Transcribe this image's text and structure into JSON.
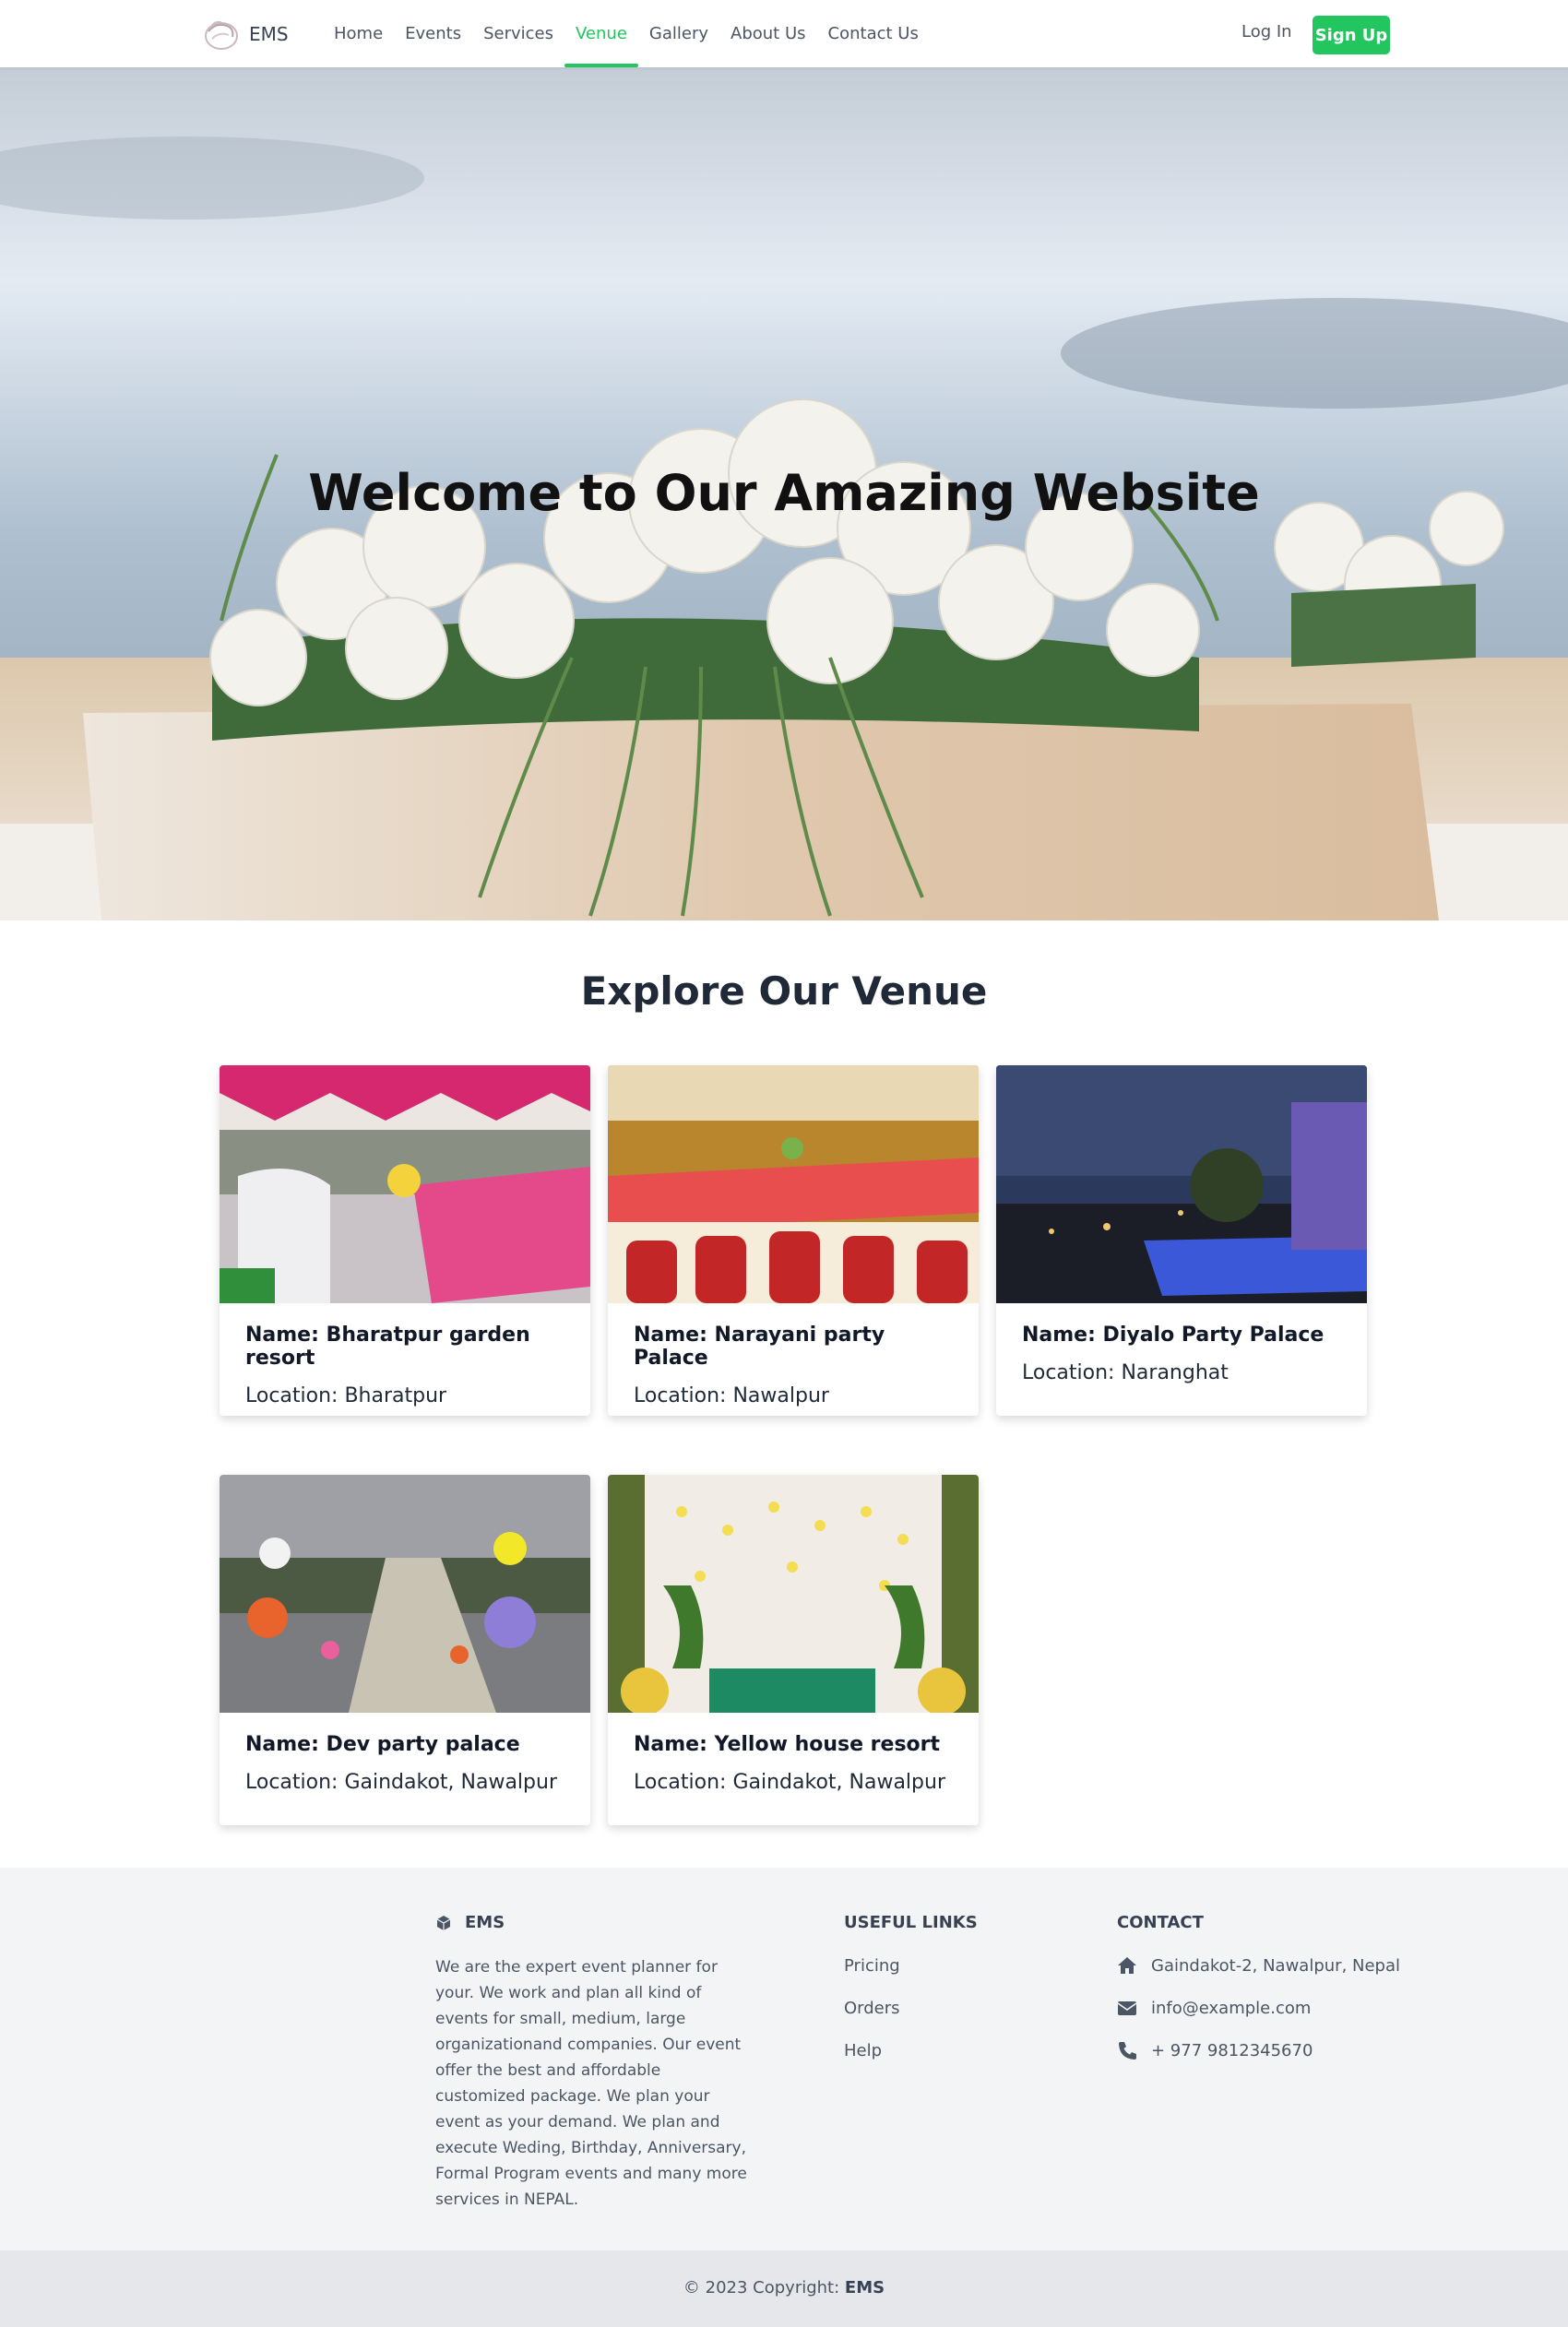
{
  "nav": {
    "brand": "EMS",
    "links": [
      {
        "label": "Home"
      },
      {
        "label": "Events"
      },
      {
        "label": "Services"
      },
      {
        "label": "Venue",
        "active": true
      },
      {
        "label": "Gallery"
      },
      {
        "label": "About Us"
      },
      {
        "label": "Contact Us"
      }
    ],
    "login": "Log In",
    "signup": "Sign Up"
  },
  "hero": {
    "title": "Welcome to Our Amazing Website"
  },
  "venues": {
    "title": "Explore Our Venue",
    "items": [
      {
        "name": "Name: Bharatpur garden resort",
        "location": "Location: Bharatpur"
      },
      {
        "name": "Name: Narayani party Palace",
        "location": "Location: Nawalpur"
      },
      {
        "name": "Name: Diyalo Party Palace",
        "location": "Location: Naranghat"
      },
      {
        "name": "Name: Dev party palace",
        "location": "Location: Gaindakot, Nawalpur"
      },
      {
        "name": "Name: Yellow house resort",
        "location": "Location: Gaindakot, Nawalpur"
      }
    ]
  },
  "footer": {
    "brand": "EMS",
    "about": "We are the expert event planner for your. We work and plan all kind of events for small, medium, large organizationand companies. Our event offer the best and affordable customized package. We plan your event as your demand. We plan and execute Weding, Birthday, Anniversary, Formal Program events and many more services in NEPAL.",
    "useful_links_title": "USEFUL LINKS",
    "useful_links": [
      "Pricing",
      "Orders",
      "Help"
    ],
    "contact_title": "CONTACT",
    "address": "Gaindakot-2, Nawalpur, Nepal",
    "email": "info@example.com",
    "phone": "+ 977 9812345670",
    "copyright_prefix": "© 2023 Copyright: ",
    "copyright_brand": "EMS"
  },
  "colors": {
    "accent": "#22c55e",
    "footer_bg": "#f3f4f6",
    "copyright_bg": "#e5e7eb"
  }
}
